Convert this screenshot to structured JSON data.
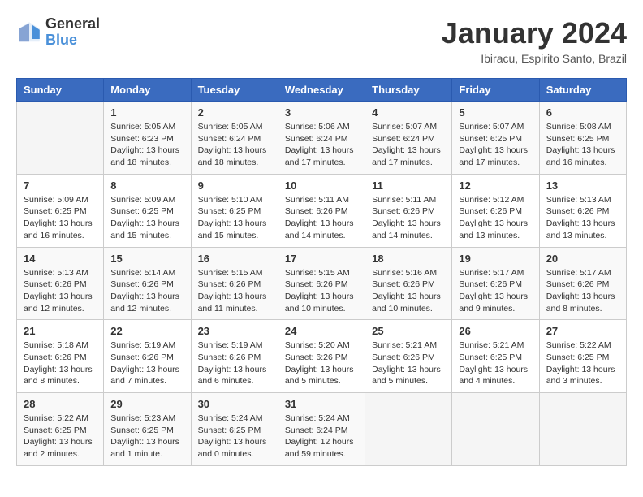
{
  "header": {
    "logo_general": "General",
    "logo_blue": "Blue",
    "title": "January 2024",
    "subtitle": "Ibiracu, Espirito Santo, Brazil"
  },
  "calendar": {
    "days_of_week": [
      "Sunday",
      "Monday",
      "Tuesday",
      "Wednesday",
      "Thursday",
      "Friday",
      "Saturday"
    ],
    "weeks": [
      [
        {
          "day": "",
          "info": ""
        },
        {
          "day": "1",
          "info": "Sunrise: 5:05 AM\nSunset: 6:23 PM\nDaylight: 13 hours\nand 18 minutes."
        },
        {
          "day": "2",
          "info": "Sunrise: 5:05 AM\nSunset: 6:24 PM\nDaylight: 13 hours\nand 18 minutes."
        },
        {
          "day": "3",
          "info": "Sunrise: 5:06 AM\nSunset: 6:24 PM\nDaylight: 13 hours\nand 17 minutes."
        },
        {
          "day": "4",
          "info": "Sunrise: 5:07 AM\nSunset: 6:24 PM\nDaylight: 13 hours\nand 17 minutes."
        },
        {
          "day": "5",
          "info": "Sunrise: 5:07 AM\nSunset: 6:25 PM\nDaylight: 13 hours\nand 17 minutes."
        },
        {
          "day": "6",
          "info": "Sunrise: 5:08 AM\nSunset: 6:25 PM\nDaylight: 13 hours\nand 16 minutes."
        }
      ],
      [
        {
          "day": "7",
          "info": "Sunrise: 5:09 AM\nSunset: 6:25 PM\nDaylight: 13 hours\nand 16 minutes."
        },
        {
          "day": "8",
          "info": "Sunrise: 5:09 AM\nSunset: 6:25 PM\nDaylight: 13 hours\nand 15 minutes."
        },
        {
          "day": "9",
          "info": "Sunrise: 5:10 AM\nSunset: 6:25 PM\nDaylight: 13 hours\nand 15 minutes."
        },
        {
          "day": "10",
          "info": "Sunrise: 5:11 AM\nSunset: 6:26 PM\nDaylight: 13 hours\nand 14 minutes."
        },
        {
          "day": "11",
          "info": "Sunrise: 5:11 AM\nSunset: 6:26 PM\nDaylight: 13 hours\nand 14 minutes."
        },
        {
          "day": "12",
          "info": "Sunrise: 5:12 AM\nSunset: 6:26 PM\nDaylight: 13 hours\nand 13 minutes."
        },
        {
          "day": "13",
          "info": "Sunrise: 5:13 AM\nSunset: 6:26 PM\nDaylight: 13 hours\nand 13 minutes."
        }
      ],
      [
        {
          "day": "14",
          "info": "Sunrise: 5:13 AM\nSunset: 6:26 PM\nDaylight: 13 hours\nand 12 minutes."
        },
        {
          "day": "15",
          "info": "Sunrise: 5:14 AM\nSunset: 6:26 PM\nDaylight: 13 hours\nand 12 minutes."
        },
        {
          "day": "16",
          "info": "Sunrise: 5:15 AM\nSunset: 6:26 PM\nDaylight: 13 hours\nand 11 minutes."
        },
        {
          "day": "17",
          "info": "Sunrise: 5:15 AM\nSunset: 6:26 PM\nDaylight: 13 hours\nand 10 minutes."
        },
        {
          "day": "18",
          "info": "Sunrise: 5:16 AM\nSunset: 6:26 PM\nDaylight: 13 hours\nand 10 minutes."
        },
        {
          "day": "19",
          "info": "Sunrise: 5:17 AM\nSunset: 6:26 PM\nDaylight: 13 hours\nand 9 minutes."
        },
        {
          "day": "20",
          "info": "Sunrise: 5:17 AM\nSunset: 6:26 PM\nDaylight: 13 hours\nand 8 minutes."
        }
      ],
      [
        {
          "day": "21",
          "info": "Sunrise: 5:18 AM\nSunset: 6:26 PM\nDaylight: 13 hours\nand 8 minutes."
        },
        {
          "day": "22",
          "info": "Sunrise: 5:19 AM\nSunset: 6:26 PM\nDaylight: 13 hours\nand 7 minutes."
        },
        {
          "day": "23",
          "info": "Sunrise: 5:19 AM\nSunset: 6:26 PM\nDaylight: 13 hours\nand 6 minutes."
        },
        {
          "day": "24",
          "info": "Sunrise: 5:20 AM\nSunset: 6:26 PM\nDaylight: 13 hours\nand 5 minutes."
        },
        {
          "day": "25",
          "info": "Sunrise: 5:21 AM\nSunset: 6:26 PM\nDaylight: 13 hours\nand 5 minutes."
        },
        {
          "day": "26",
          "info": "Sunrise: 5:21 AM\nSunset: 6:25 PM\nDaylight: 13 hours\nand 4 minutes."
        },
        {
          "day": "27",
          "info": "Sunrise: 5:22 AM\nSunset: 6:25 PM\nDaylight: 13 hours\nand 3 minutes."
        }
      ],
      [
        {
          "day": "28",
          "info": "Sunrise: 5:22 AM\nSunset: 6:25 PM\nDaylight: 13 hours\nand 2 minutes."
        },
        {
          "day": "29",
          "info": "Sunrise: 5:23 AM\nSunset: 6:25 PM\nDaylight: 13 hours\nand 1 minute."
        },
        {
          "day": "30",
          "info": "Sunrise: 5:24 AM\nSunset: 6:25 PM\nDaylight: 13 hours\nand 0 minutes."
        },
        {
          "day": "31",
          "info": "Sunrise: 5:24 AM\nSunset: 6:24 PM\nDaylight: 12 hours\nand 59 minutes."
        },
        {
          "day": "",
          "info": ""
        },
        {
          "day": "",
          "info": ""
        },
        {
          "day": "",
          "info": ""
        }
      ]
    ]
  }
}
